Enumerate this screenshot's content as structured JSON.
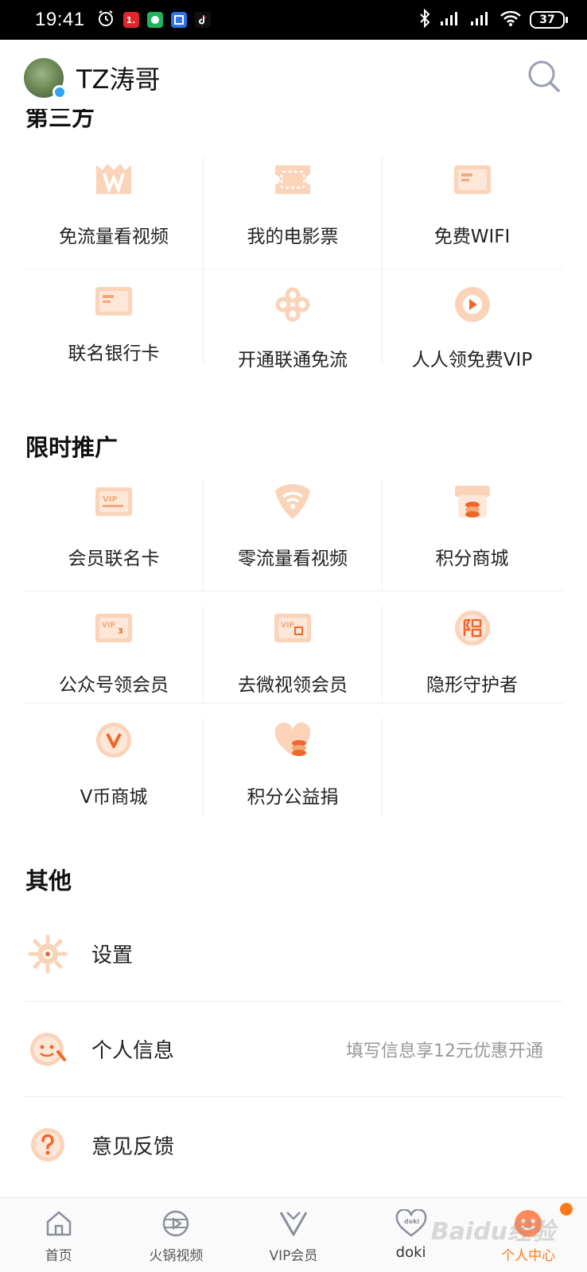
{
  "status_bar": {
    "time": "19:41",
    "app_badge_1": "1.",
    "battery": "37"
  },
  "header": {
    "username": "TZ涛哥"
  },
  "section_1": {
    "title": "第三方",
    "items": [
      {
        "label": "免流量看视频",
        "icon": "crown-w-icon"
      },
      {
        "label": "我的电影票",
        "icon": "ticket-icon"
      },
      {
        "label": "免费WIFI",
        "icon": "card-icon"
      },
      {
        "label": "联名银行卡",
        "icon": "bank-card-icon"
      },
      {
        "label": "开通联通免流",
        "icon": "unicom-knot-icon"
      },
      {
        "label": "人人领免费VIP",
        "icon": "play-circle-icon"
      }
    ]
  },
  "section_2": {
    "title": "限时推广",
    "items": [
      {
        "label": "会员联名卡",
        "icon": "vip-card-icon"
      },
      {
        "label": "零流量看视频",
        "icon": "wifi-shield-icon"
      },
      {
        "label": "积分商城",
        "icon": "coin-store-icon"
      },
      {
        "label": "公众号领会员",
        "icon": "vip-3day-card-icon"
      },
      {
        "label": "去微视领会员",
        "icon": "vip-month-card-icon"
      },
      {
        "label": "隐形守护者",
        "icon": "hidden-seal-icon"
      },
      {
        "label": "V币商城",
        "icon": "v-coin-icon"
      },
      {
        "label": "积分公益捐",
        "icon": "heart-coins-icon"
      }
    ]
  },
  "section_3": {
    "title": "其他",
    "items": [
      {
        "label": "设置",
        "hint": "",
        "icon": "gear-icon"
      },
      {
        "label": "个人信息",
        "hint": "填写信息享12元优惠开通",
        "icon": "face-wrench-icon"
      },
      {
        "label": "意见反馈",
        "hint": "",
        "icon": "question-icon"
      }
    ]
  },
  "bottom_nav": {
    "items": [
      {
        "label": "首页",
        "icon": "home-icon"
      },
      {
        "label": "火锅视频",
        "icon": "film-reel-icon"
      },
      {
        "label": "VIP会员",
        "icon": "vip-v-icon"
      },
      {
        "label": "doki",
        "icon": "doki-heart-icon"
      },
      {
        "label": "个人中心",
        "icon": "profile-face-icon"
      }
    ]
  },
  "watermark": "Baidu经验",
  "colors": {
    "accent": "#ff7a1a",
    "icon_light": "#fbd3b8",
    "icon_mid": "#f5a877"
  }
}
